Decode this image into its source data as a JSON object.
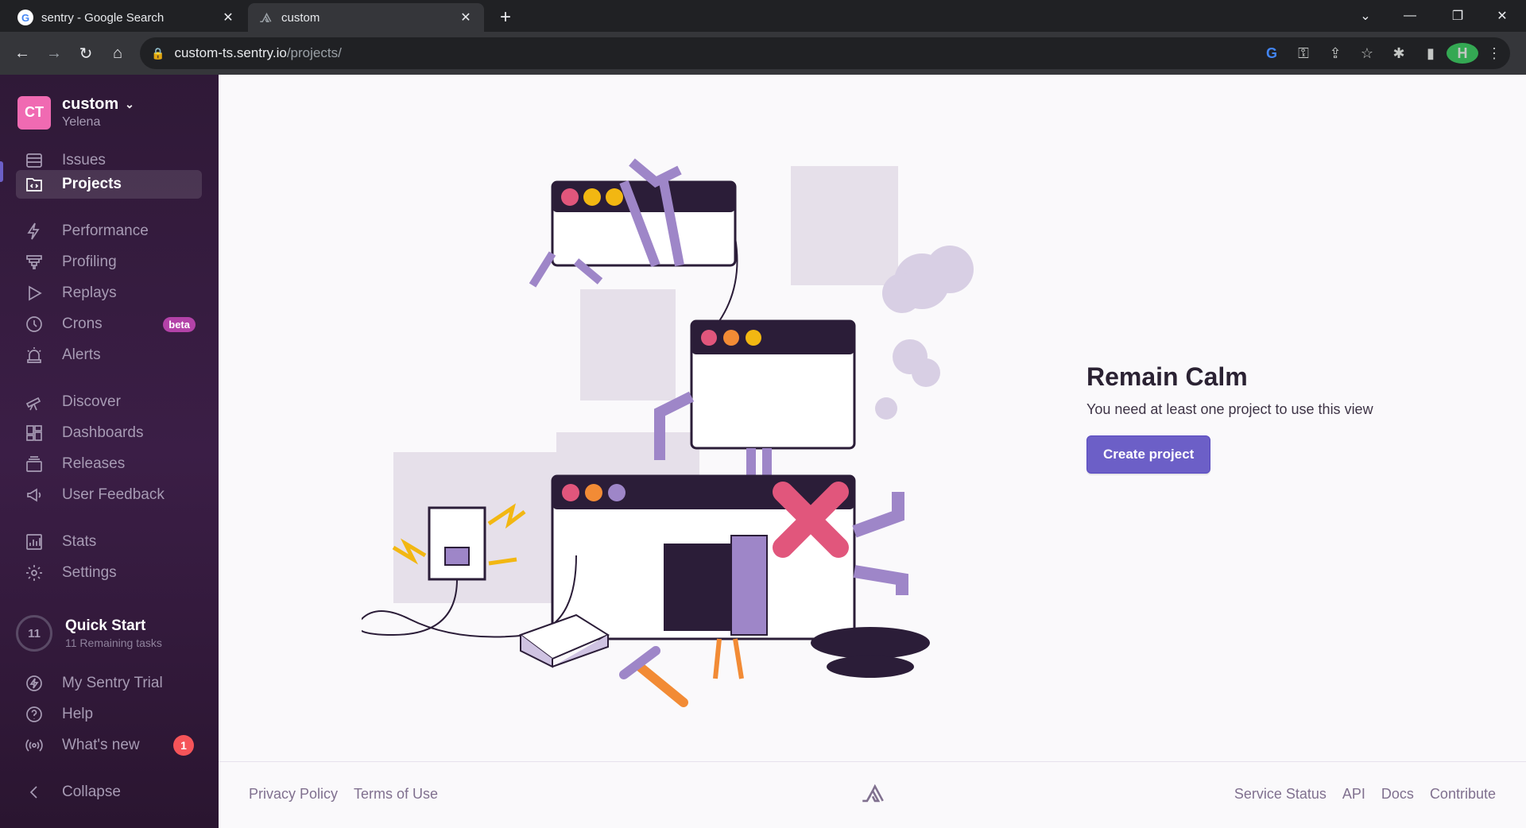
{
  "browser": {
    "tabs": [
      {
        "title": "sentry - Google Search",
        "favicon": "google-icon"
      },
      {
        "title": "custom",
        "favicon": "sentry-icon"
      }
    ],
    "url_host": "custom-ts.sentry.io",
    "url_path": "/projects/",
    "profile_initial": "H"
  },
  "sidebar": {
    "org": {
      "initials": "CT",
      "name": "custom",
      "user": "Yelena"
    },
    "items": [
      {
        "label": "Issues"
      },
      {
        "label": "Projects"
      },
      {
        "label": "Performance"
      },
      {
        "label": "Profiling"
      },
      {
        "label": "Replays"
      },
      {
        "label": "Crons",
        "badge": "beta"
      },
      {
        "label": "Alerts"
      },
      {
        "label": "Discover"
      },
      {
        "label": "Dashboards"
      },
      {
        "label": "Releases"
      },
      {
        "label": "User Feedback"
      },
      {
        "label": "Stats"
      },
      {
        "label": "Settings"
      }
    ],
    "quick_start": {
      "count": "11",
      "title": "Quick Start",
      "subtitle": "11 Remaining tasks"
    },
    "bottom": [
      {
        "label": "My Sentry Trial"
      },
      {
        "label": "Help"
      },
      {
        "label": "What's new",
        "count": "1"
      },
      {
        "label": "Collapse"
      }
    ]
  },
  "main": {
    "heading": "Remain Calm",
    "message": "You need at least one project to use this view",
    "button": "Create project"
  },
  "footer": {
    "left": [
      "Privacy Policy",
      "Terms of Use"
    ],
    "right": [
      "Service Status",
      "API",
      "Docs",
      "Contribute"
    ]
  },
  "colors": {
    "accent": "#6c5fc7",
    "sidebar": "#2f1937",
    "badge": "#b342a8",
    "alert": "#f55459"
  }
}
